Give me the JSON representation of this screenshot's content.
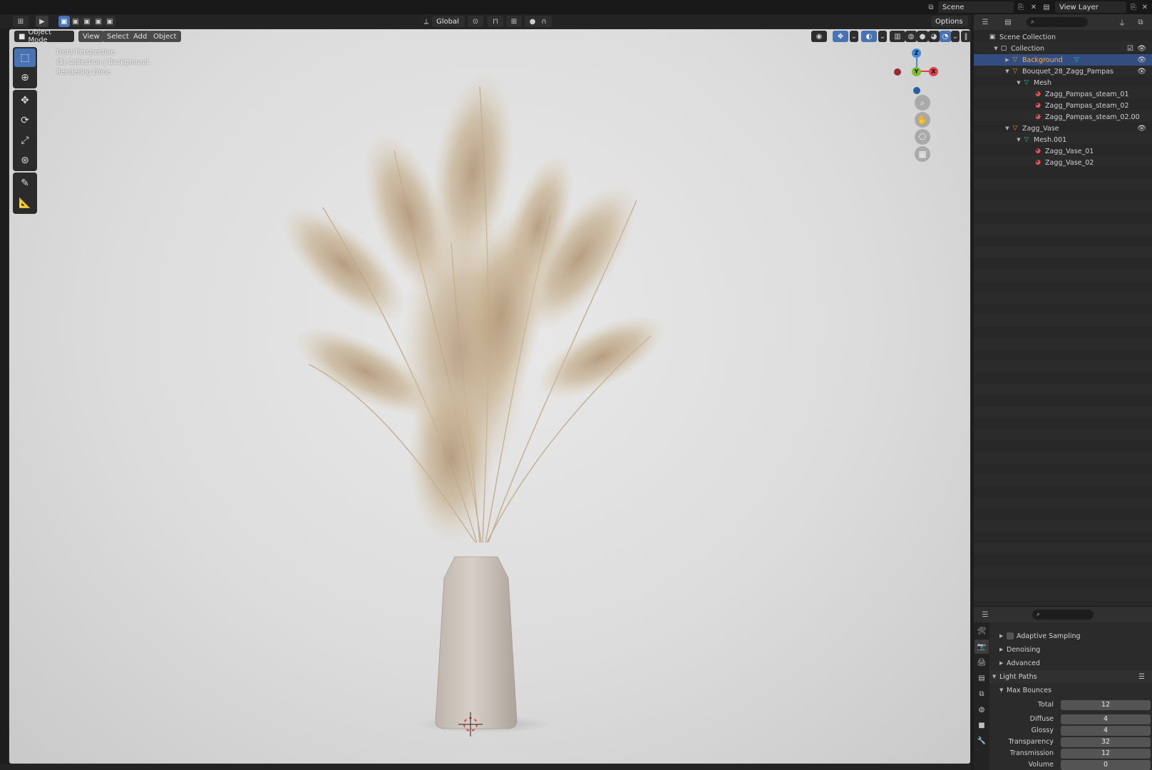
{
  "topbar": {
    "scene": "Scene",
    "view_layer": "View Layer"
  },
  "viewport_toolbar": {
    "transform_orientation": "Global",
    "options": "Options"
  },
  "viewport_header": {
    "mode": "Object Mode",
    "menu": [
      "View",
      "Select",
      "Add",
      "Object"
    ]
  },
  "overlay": {
    "line1": "Front Perspective",
    "line2": "(1) Collection | Background",
    "line3": "Rendering Done"
  },
  "gizmo": {
    "z": "Z",
    "y": "Y",
    "x": "X"
  },
  "outliner": {
    "rows": [
      {
        "label": "Scene Collection",
        "indent": 0,
        "icon": "scene-collection-icon",
        "eye": false,
        "selected": false,
        "tri": ""
      },
      {
        "label": "Collection",
        "indent": 1,
        "icon": "collection-icon",
        "eye": true,
        "checkbox": true,
        "selected": false,
        "tri": "▼"
      },
      {
        "label": "Background",
        "indent": 2,
        "icon": "object-icon",
        "eye": true,
        "selected": true,
        "tri": "▶"
      },
      {
        "label": "Bouquet_28_Zagg_Pampas",
        "indent": 2,
        "icon": "object-icon",
        "eye": true,
        "selected": false,
        "tri": "▼"
      },
      {
        "label": "Mesh",
        "indent": 3,
        "icon": "mesh-icon",
        "eye": false,
        "selected": false,
        "tri": "▼"
      },
      {
        "label": "Zagg_Pampas_steam_01",
        "indent": 4,
        "icon": "material-icon",
        "eye": false,
        "selected": false,
        "tri": ""
      },
      {
        "label": "Zagg_Pampas_steam_02",
        "indent": 4,
        "icon": "material-icon",
        "eye": false,
        "selected": false,
        "tri": ""
      },
      {
        "label": "Zagg_Pampas_steam_02.00",
        "indent": 4,
        "icon": "material-icon",
        "eye": false,
        "selected": false,
        "tri": ""
      },
      {
        "label": "Zagg_Vase",
        "indent": 2,
        "icon": "object-icon",
        "eye": true,
        "selected": false,
        "tri": "▼"
      },
      {
        "label": "Mesh.001",
        "indent": 3,
        "icon": "mesh-icon",
        "eye": false,
        "selected": false,
        "tri": "▼"
      },
      {
        "label": "Zagg_Vase_01",
        "indent": 4,
        "icon": "material-icon",
        "eye": false,
        "selected": false,
        "tri": ""
      },
      {
        "label": "Zagg_Vase_02",
        "indent": 4,
        "icon": "material-icon",
        "eye": false,
        "selected": false,
        "tri": ""
      }
    ]
  },
  "properties": {
    "sections": [
      {
        "label": "Adaptive Sampling",
        "collapsed": true,
        "checkbox": true
      },
      {
        "label": "Denoising",
        "collapsed": true
      },
      {
        "label": "Advanced",
        "collapsed": true
      },
      {
        "label": "Light Paths",
        "collapsed": false
      },
      {
        "label": "Max Bounces",
        "collapsed": false
      }
    ],
    "fields": [
      {
        "label": "Total",
        "value": "12"
      },
      {
        "label": "Diffuse",
        "value": "4"
      },
      {
        "label": "Glossy",
        "value": "4"
      },
      {
        "label": "Transparency",
        "value": "32"
      },
      {
        "label": "Transmission",
        "value": "12"
      },
      {
        "label": "Volume",
        "value": "0"
      }
    ]
  },
  "colors": {
    "accent": "#4772b3",
    "selected_row": "#334d80",
    "selected_text": "#ffaf3f",
    "axis_x": "#e0404b",
    "axis_y": "#7fbf2a",
    "axis_z": "#3d8ae0"
  }
}
